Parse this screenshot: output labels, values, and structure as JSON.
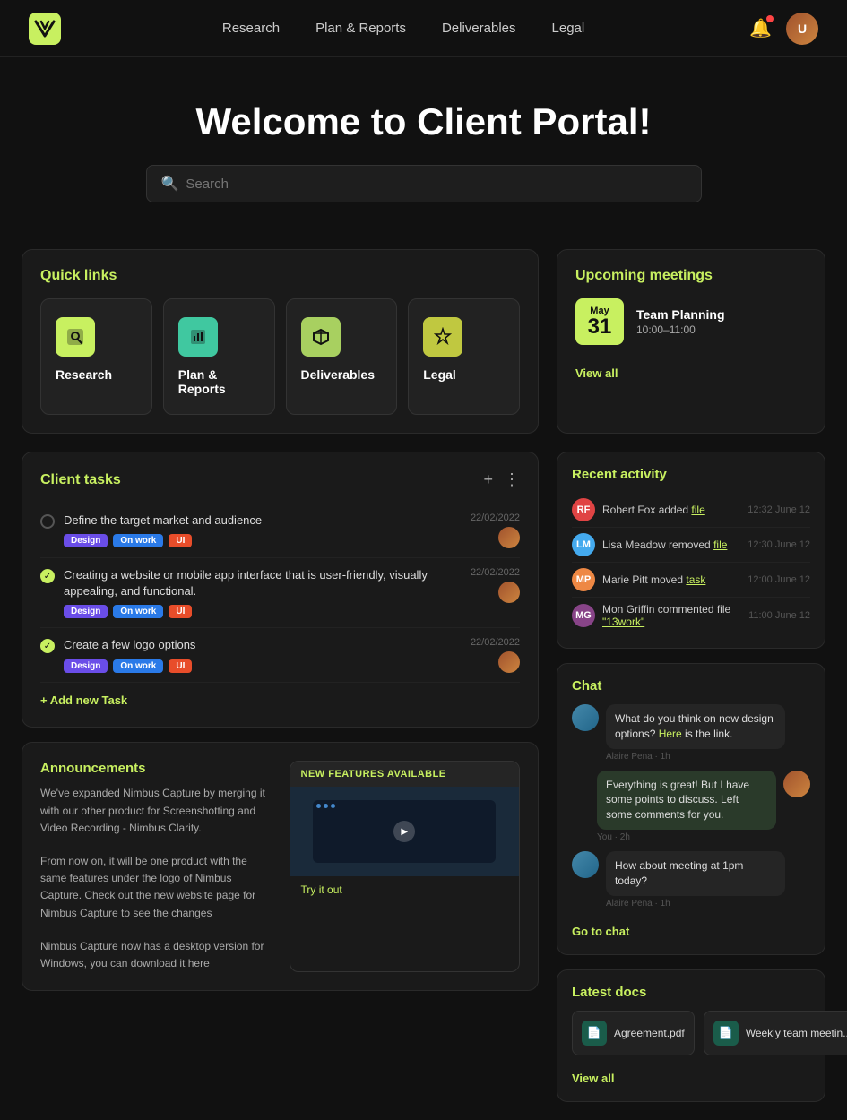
{
  "nav": {
    "links": [
      "Research",
      "Plan & Reports",
      "Deliverables",
      "Legal"
    ]
  },
  "hero": {
    "title": "Welcome to Client Portal!",
    "search_placeholder": "Search"
  },
  "quick_links": {
    "title": "Quick links",
    "items": [
      {
        "label": "Research",
        "icon": "🔍",
        "color": "green"
      },
      {
        "label": "Plan & Reports",
        "icon": "📊",
        "color": "teal"
      },
      {
        "label": "Deliverables",
        "icon": "📦",
        "color": "lime"
      },
      {
        "label": "Legal",
        "icon": "⚖️",
        "color": "olive"
      }
    ]
  },
  "upcoming": {
    "title": "Upcoming meetings",
    "meeting": {
      "month": "May",
      "day": "31",
      "title": "Team Planning",
      "time": "10:00–11:00"
    },
    "view_all": "View all"
  },
  "client_tasks": {
    "title": "Client tasks",
    "add_label": "+ Add new Task",
    "tasks": [
      {
        "done": false,
        "text": "Define the target market and audience",
        "tags": [
          "Design",
          "On work",
          "UI"
        ],
        "date": "22/02/2022"
      },
      {
        "done": true,
        "text": "Creating a website or mobile app interface that is user-friendly, visually appealing, and functional.",
        "tags": [
          "Design",
          "On work",
          "UI"
        ],
        "date": "22/02/2022"
      },
      {
        "done": true,
        "text": "Create a few logo options",
        "tags": [
          "Design",
          "On work",
          "UI"
        ],
        "date": "22/02/2022"
      }
    ]
  },
  "recent_activity": {
    "title": "Recent activity",
    "items": [
      {
        "user": "Robert Fox",
        "action": "added",
        "link": "file",
        "time": "12:32 June 12",
        "initials": "RF",
        "color": "#e04444"
      },
      {
        "user": "Lisa Meadow",
        "action": "removed",
        "link": "file",
        "time": "12:30 June 12",
        "initials": "LM",
        "color": "#44aaee"
      },
      {
        "user": "Marie Pitt",
        "action": "moved",
        "link": "task",
        "time": "12:00 June 12",
        "initials": "MP",
        "color": "#ee8844"
      },
      {
        "user": "Mon Griffin",
        "action": "commented file",
        "link": "\"13work\"",
        "time": "11:00 June 12",
        "initials": "MG",
        "color": "#884488"
      }
    ]
  },
  "chat": {
    "title": "Chat",
    "messages": [
      {
        "sender": "Alaire Pena",
        "text": "What do you think on new design options? Here is the link.",
        "link": "Here",
        "time": "Alaire Pena · 1h",
        "align": "left"
      },
      {
        "sender": "You",
        "text": "Everything is great! But I have some points to discuss. Left some comments for you.",
        "time": "You · 2h",
        "align": "right"
      },
      {
        "sender": "Alaire Pena",
        "text": "How about meeting at 1pm today?",
        "time": "Alaire Pena · 1h",
        "align": "left"
      }
    ],
    "go_to_chat": "Go to chat"
  },
  "latest_docs": {
    "title": "Latest docs",
    "docs": [
      {
        "name": "Agreement.pdf",
        "icon": "📄"
      },
      {
        "name": "Weekly team meetin...",
        "icon": "📄"
      }
    ],
    "view_all": "View all"
  },
  "announcements": {
    "title": "Announcements",
    "text1": "We've expanded Nimbus Capture by merging it with our other product for Screenshotting and Video Recording - Nimbus Clarity.",
    "text2": "From now on, it will be one product with the same features under the logo of Nimbus Capture. Check out the new website page for Nimbus Capture to see the changes",
    "text3": "Nimbus Capture now has a desktop version for Windows, you can download it here",
    "new_feature_label": "NEW FEATURES AVAILABLE",
    "try_it_out": "Try it out"
  }
}
